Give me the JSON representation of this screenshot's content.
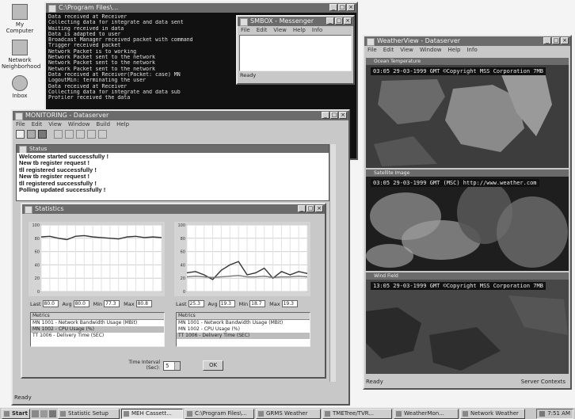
{
  "desktop": {
    "icons": [
      {
        "label": "My Computer",
        "icon": "computer-icon"
      },
      {
        "label": "Network Neighborhood",
        "icon": "network-icon"
      },
      {
        "label": "Inbox",
        "icon": "inbox-icon"
      }
    ]
  },
  "console": {
    "title": "C:\\Program Files\\...",
    "lines": [
      "Data received at Receiver",
      "Collecting data for integrate and data sent",
      "Waiting received in data",
      "Data is adapted to user",
      "Broadcast Manager received packet with command",
      "Trigger received packet",
      "Network Packet is to working",
      "Network Packet sent to the network",
      "Network Packet sent to the network",
      "Network Packet sent to the network",
      "Data received at Receiver(Packet: case) MN",
      "LogoutMin: terminating the user",
      "Data received at Receiver",
      "Collecting data for integrate and data sub",
      "Profiler received the data"
    ]
  },
  "small_window": {
    "title": "SMBOX - Messenger",
    "menu": [
      "File",
      "Edit",
      "View",
      "Help",
      "Info"
    ],
    "status": "Ready"
  },
  "main_window": {
    "title": "MONITORING - Dataserver",
    "menu": [
      "File",
      "Edit",
      "View",
      "Window",
      "Build",
      "Help"
    ],
    "log_title": "Status",
    "log_lines": [
      "Welcome started successfully !",
      "New tb register request !",
      "tll registered successfully !",
      "New tb register request !",
      "tll registered successfully !",
      "Polling updated successfully !"
    ],
    "status": "Ready"
  },
  "inner_window": {
    "title": "Statistics",
    "left_fields": [
      {
        "label": "Last",
        "value": "80.0"
      },
      {
        "label": "Avg",
        "value": "80.0"
      },
      {
        "label": "Min",
        "value": "77.3"
      },
      {
        "label": "Max",
        "value": "80.8"
      }
    ],
    "right_fields": [
      {
        "label": "Last",
        "value": "25.3"
      },
      {
        "label": "Avg",
        "value": "19.3"
      },
      {
        "label": "Min",
        "value": "18.7"
      },
      {
        "label": "Max",
        "value": "19.3"
      }
    ],
    "left_list": {
      "header": "Metrics",
      "rows": [
        "MN 1001 - Network Bandwidth Usage (MBit)",
        "MN 1002 - CPU Usage (%)",
        "TT 1006 - Delivery Time (SEC)"
      ]
    },
    "right_list": {
      "header": "Metrics",
      "rows": [
        "MN 1001 - Network Bandwidth Usage (MBit)",
        "MN 1002 - CPU Usage (%)",
        "TT 1006 - Delivery Time (SEC)"
      ]
    },
    "interval_label": "Time Interval (Sec):",
    "interval_value": "5",
    "ok_label": "OK"
  },
  "chart_data": [
    {
      "type": "line",
      "ylim": [
        0,
        100
      ],
      "x": [
        0,
        1,
        2,
        3,
        4,
        5,
        6,
        7,
        8,
        9,
        10,
        11,
        12,
        13,
        14
      ],
      "series": [
        {
          "values": [
            82,
            83,
            80,
            78,
            83,
            84,
            82,
            81,
            80,
            79,
            82,
            83,
            81,
            82,
            81
          ]
        }
      ],
      "yticks": [
        0,
        20,
        40,
        60,
        80,
        100
      ]
    },
    {
      "type": "line",
      "ylim": [
        0,
        100
      ],
      "x": [
        0,
        1,
        2,
        3,
        4,
        5,
        6,
        7,
        8,
        9,
        10,
        11,
        12,
        13,
        14
      ],
      "series": [
        {
          "values": [
            28,
            30,
            25,
            18,
            32,
            40,
            45,
            25,
            28,
            35,
            20,
            30,
            25,
            30,
            27
          ]
        },
        {
          "values": [
            22,
            23,
            22,
            21,
            22,
            23,
            24,
            22,
            22,
            23,
            21,
            22,
            22,
            23,
            22
          ]
        }
      ],
      "yticks": [
        0,
        20,
        40,
        60,
        80,
        100
      ]
    }
  ],
  "sat_window": {
    "title": "WeatherView - Dataserver",
    "menu": [
      "File",
      "Edit",
      "View",
      "Window",
      "Help",
      "Info"
    ],
    "panels": [
      {
        "title": "Ocean Temperature",
        "overlay": "03:05 29-03-1999 GMT ©Copyright MSS Corporation  7MB"
      },
      {
        "title": "Satellite Image",
        "overlay": "03:05 29-03-1999 GMT (MSC) http://www.weather.com"
      },
      {
        "title": "Wind Field",
        "overlay": "13:05 29-03-1999 GMT ©Copyright MSS Corporation  7MB"
      }
    ],
    "status_left": "Ready",
    "status_right": "Server Contexts"
  },
  "taskbar": {
    "start": "Start",
    "buttons": [
      "Statistic Setup",
      "MEH Cassett...",
      "C:\\Program Files\\...",
      "GRMS Weather",
      "TMETree/TVR...",
      "WeatherMon...",
      "Network Weather"
    ],
    "active_index": 1,
    "clock": "7:51 AM"
  }
}
